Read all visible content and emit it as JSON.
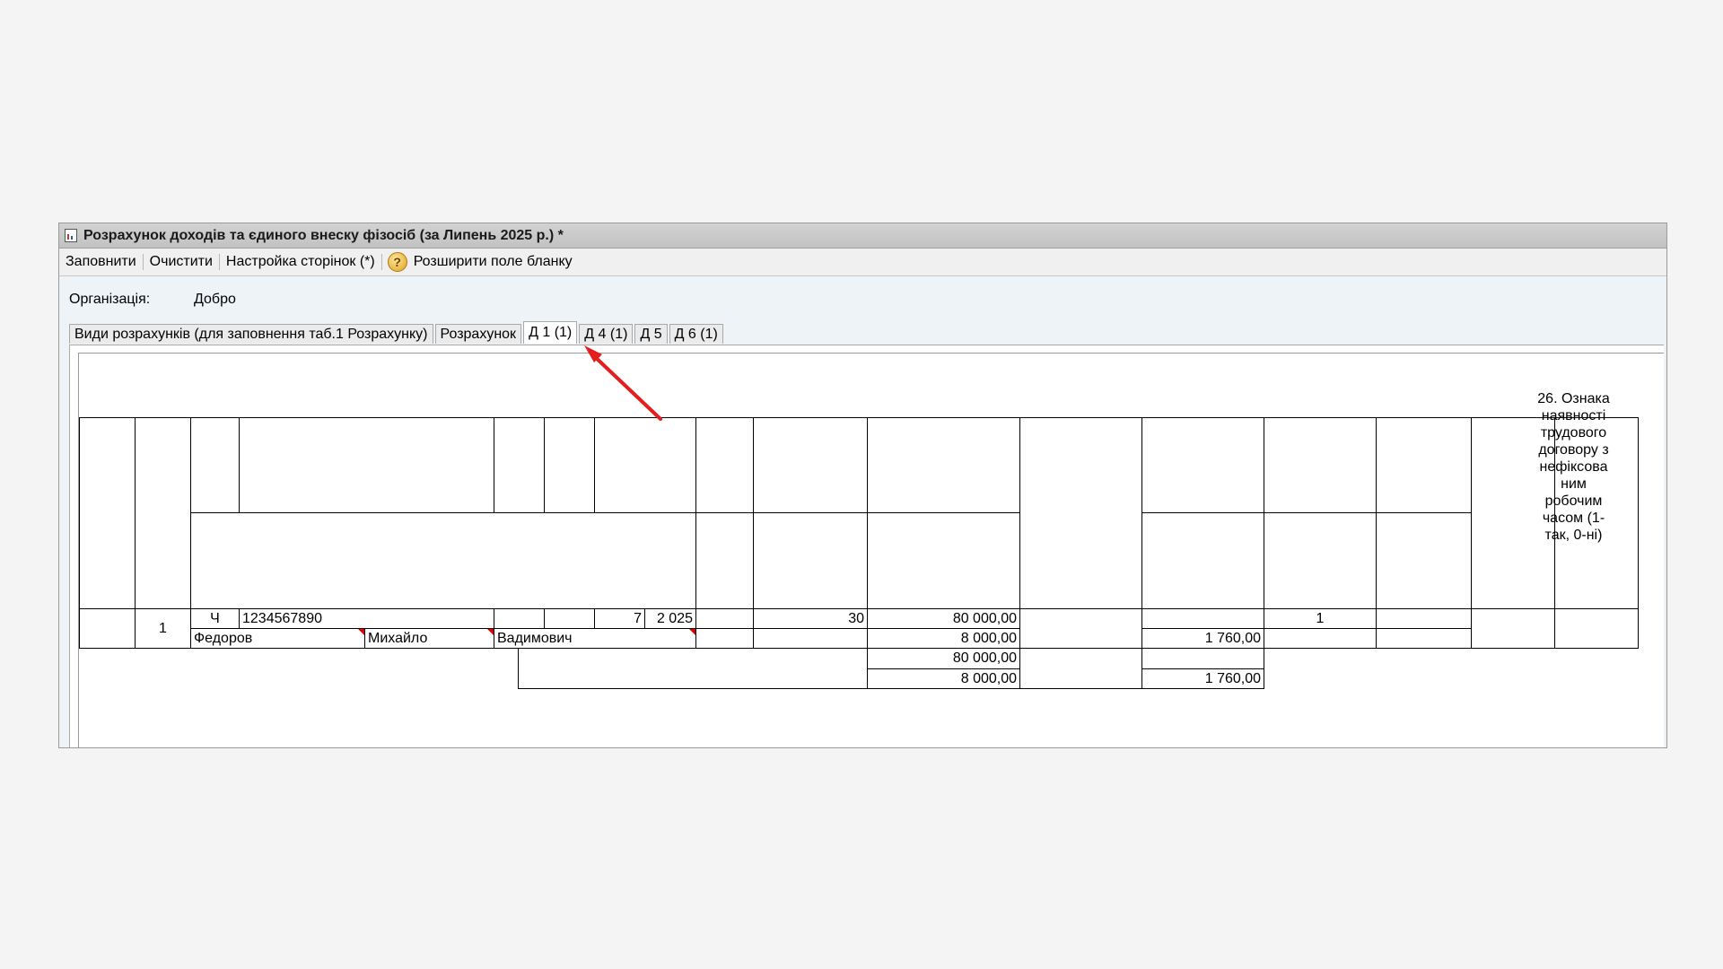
{
  "window": {
    "title": "Розрахунок доходів та єдиного внеску фізосіб (за Липень 2025 р.) *"
  },
  "toolbar": {
    "fill_label": "Заповнити",
    "clear_label": "Очистити",
    "pages_label": "Настройка сторінок (*)",
    "help_glyph": "?",
    "expand_label": "Розширити поле бланку"
  },
  "org": {
    "label": "Організація:",
    "value": "Добро"
  },
  "tabs": [
    {
      "label": "Види розрахунків (для заповнення таб.1 Розрахунку)"
    },
    {
      "label": "Розрахунок"
    },
    {
      "label": "Д 1 (1)",
      "active": true
    },
    {
      "label": "Д 4 (1)"
    },
    {
      "label": "Д 5"
    },
    {
      "label": "Д 6 (1)"
    }
  ],
  "table": {
    "header_col26": "26. Ознака наявності трудового договору з нефіксова ним робочим часом (1-так, 0-ні)",
    "row": {
      "num": "1",
      "gender": "Ч",
      "tax_id": "1234567890",
      "month": "7",
      "year": "2 025",
      "days": "30",
      "income": "80 000,00",
      "col_flag": "1",
      "surname": "Федоров",
      "name": "Михайло",
      "patronymic": "Вадимович",
      "contribution_base": "8 000,00",
      "contribution": "1 760,00"
    },
    "totals": {
      "income": "80 000,00",
      "contribution_base": "8 000,00",
      "contribution": "1 760,00"
    }
  },
  "colors": {
    "arrow": "#e41e1e",
    "mark": "#e00000"
  }
}
